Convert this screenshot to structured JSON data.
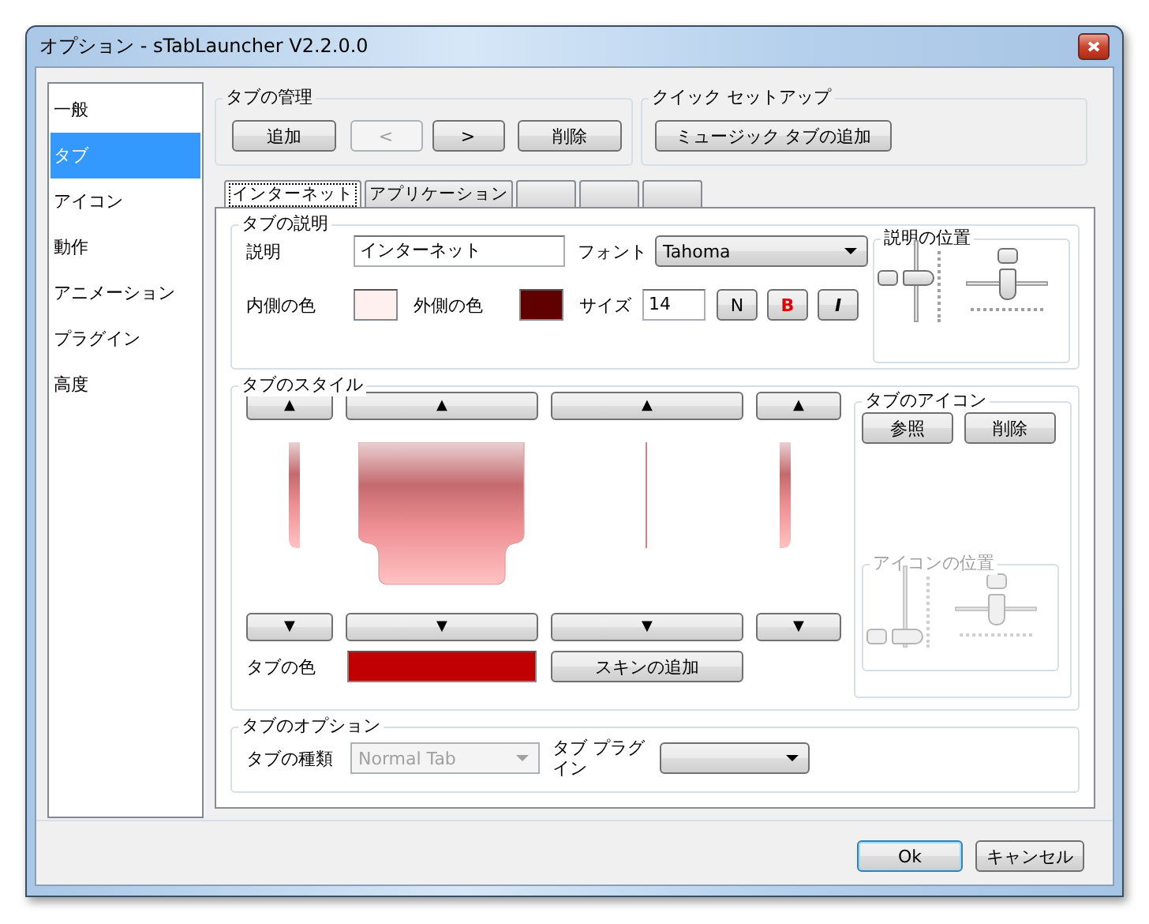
{
  "window": {
    "title": "オプション - sTabLauncher V2.2.0.0"
  },
  "sidebar": {
    "items": [
      {
        "label": "一般",
        "selected": false
      },
      {
        "label": "タブ",
        "selected": true
      },
      {
        "label": "アイコン",
        "selected": false
      },
      {
        "label": "動作",
        "selected": false
      },
      {
        "label": "アニメーション",
        "selected": false
      },
      {
        "label": "プラグイン",
        "selected": false
      },
      {
        "label": "高度",
        "selected": false
      }
    ]
  },
  "tab_management": {
    "title": "タブの管理",
    "buttons": [
      {
        "label": "追加",
        "disabled": false
      },
      {
        "label": "<",
        "disabled": true
      },
      {
        "label": ">",
        "disabled": false
      },
      {
        "label": "削除",
        "disabled": false
      }
    ]
  },
  "quick_setup": {
    "title": "クイック セットアップ",
    "button": "ミュージック タブの追加"
  },
  "tabs": [
    {
      "label": "インターネット",
      "selected": true
    },
    {
      "label": "アプリケーション",
      "selected": false
    },
    {
      "selected": false
    },
    {
      "selected": false
    },
    {
      "selected": false
    }
  ],
  "tab_description": {
    "title": "タブの説明",
    "description_label": "説明",
    "description_value": "インターネット",
    "font_label": "フォント",
    "font_value": "Tahoma",
    "inner_color": {
      "label": "内側の色",
      "color": "#fff0f0"
    },
    "outer_color": {
      "label": "外側の色",
      "color": "#600000"
    },
    "size_label": "サイズ",
    "size_value": "14",
    "style_buttons": [
      {
        "label": "N",
        "kind": "normal"
      },
      {
        "label": "B",
        "kind": "bold"
      },
      {
        "label": "I",
        "kind": "italic"
      }
    ],
    "position": {
      "title": "説明の位置",
      "disabled": false,
      "sliders": [
        {
          "kind": "vertical",
          "level": 0.55
        },
        {
          "kind": "horizontal",
          "level": 0.5
        }
      ]
    }
  },
  "tab_style": {
    "title": "タブのスタイル",
    "up_buttons": [
      "▲",
      "▲",
      "▲",
      "▲"
    ],
    "down_buttons": [
      "▼",
      "▼",
      "▼",
      "▼"
    ],
    "tab_color": {
      "label": "タブの色",
      "color": "#c00000"
    },
    "add_skin_button": "スキンの追加",
    "icon": {
      "title": "タブのアイコン",
      "buttons": [
        "参照",
        "削除"
      ],
      "position": {
        "title": "アイコンの位置",
        "disabled": true,
        "sliders": [
          {
            "kind": "vertical",
            "level": 0.05
          },
          {
            "kind": "horizontal",
            "level": 0.5
          }
        ]
      }
    }
  },
  "tab_options": {
    "title": "タブのオプション",
    "type_label": "タブの種類",
    "type_value": "Normal Tab",
    "type_disabled": true,
    "plugin_label": "タブ プラグイン"
  },
  "footer": {
    "buttons": [
      {
        "label": "Ok",
        "default": true
      },
      {
        "label": "キャンセル",
        "default": false
      }
    ]
  }
}
